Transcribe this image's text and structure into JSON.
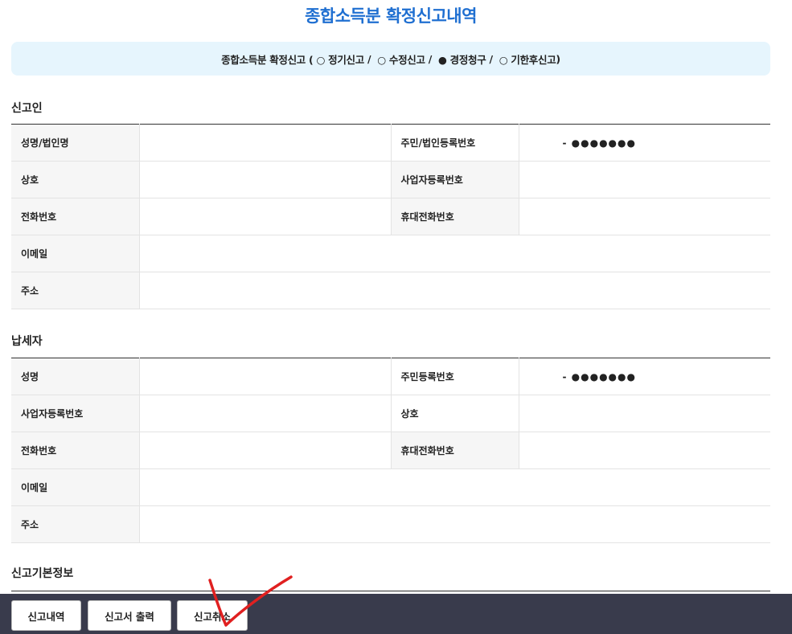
{
  "page": {
    "title": "종합소득분 확정신고내역"
  },
  "filing_type": {
    "prefix": "종합소득분 확정신고 (",
    "suffix": ")",
    "separator": "/",
    "options": [
      {
        "symbol": "○",
        "label": "정기신고"
      },
      {
        "symbol": "○",
        "label": "수정신고"
      },
      {
        "symbol": "●",
        "label": "경정청구"
      },
      {
        "symbol": "○",
        "label": "기한후신고"
      }
    ]
  },
  "reporter": {
    "title": "신고인",
    "name_label": "성명/법인명",
    "id_label": "주민/법인등록번호",
    "id_value": "- ●●●●●●●",
    "trade_name_label": "상호",
    "biz_no_label": "사업자등록번호",
    "phone_label": "전화번호",
    "mobile_label": "휴대전화번호",
    "email_label": "이메일",
    "address_label": "주소"
  },
  "taxpayer": {
    "title": "납세자",
    "name_label": "성명",
    "id_label": "주민등록번호",
    "id_value": "- ●●●●●●●",
    "biz_no_label": "사업자등록번호",
    "trade_name_label": "상호",
    "phone_label": "전화번호",
    "mobile_label": "휴대전화번호",
    "email_label": "이메일",
    "address_label": "주소"
  },
  "basic_info": {
    "title": "신고기본정보"
  },
  "buttons": {
    "history": "신고내역",
    "print": "신고서 출력",
    "cancel": "신고취소"
  },
  "colors": {
    "title": "#1f6fd1",
    "type_box_bg": "#e6f5fd",
    "bottom_bar": "#393b4c",
    "annotation": "#e02020"
  }
}
